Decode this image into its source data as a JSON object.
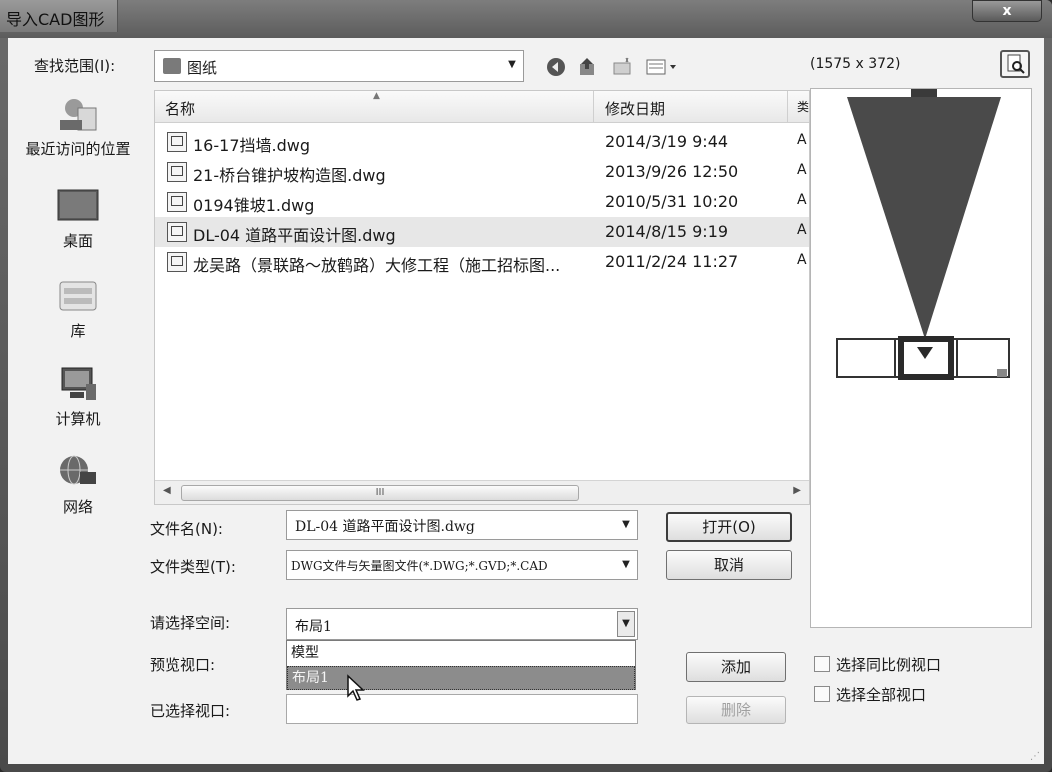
{
  "window": {
    "title": "导入CAD图形",
    "close_glyph": "x"
  },
  "lookin": {
    "label": "查找范围(I):",
    "value": "图纸"
  },
  "toolbar": {
    "back_icon": "globe-back-icon",
    "up_icon": "up-folder-icon",
    "newfolder_icon": "new-folder-icon",
    "views_icon": "views-menu-icon"
  },
  "places": [
    {
      "label": "最近访问的位置",
      "icon": "recent-places-icon"
    },
    {
      "label": "桌面",
      "icon": "desktop-icon"
    },
    {
      "label": "库",
      "icon": "libraries-icon"
    },
    {
      "label": "计算机",
      "icon": "computer-icon"
    },
    {
      "label": "网络",
      "icon": "network-icon"
    }
  ],
  "filelist": {
    "columns": [
      "名称",
      "修改日期",
      "类"
    ],
    "rows": [
      {
        "name": "16-17挡墙.dwg",
        "date": "2014/3/19 9:44",
        "extra": "A",
        "selected": false
      },
      {
        "name": "21-桥台锥护坡构造图.dwg",
        "date": "2013/9/26 12:50",
        "extra": "A",
        "selected": false
      },
      {
        "name": "0194锥坡1.dwg",
        "date": "2010/5/31 10:20",
        "extra": "A",
        "selected": false
      },
      {
        "name": "DL-04 道路平面设计图.dwg",
        "date": "2014/8/15 9:19",
        "extra": "A",
        "selected": true
      },
      {
        "name": "龙吴路（景联路～放鹤路）大修工程（施工招标图...",
        "date": "2011/2/24 11:27",
        "extra": "A",
        "selected": false
      }
    ],
    "scroll_glyph": "III"
  },
  "filename": {
    "label": "文件名(N):",
    "value": "DL-04 道路平面设计图.dwg"
  },
  "filetype": {
    "label": "文件类型(T):",
    "value": "DWG文件与矢量图文件(*.DWG;*.GVD;*.CAD"
  },
  "buttons": {
    "open": "打开(O)",
    "cancel": "取消",
    "add": "添加",
    "delete": "删除"
  },
  "space": {
    "label": "请选择空间:",
    "value": "布局1",
    "options": [
      "模型",
      "布局1"
    ],
    "highlighted": 1
  },
  "preview_viewport": {
    "label": "预览视口:"
  },
  "selected_viewport": {
    "label": "已选择视口:",
    "value": ""
  },
  "preview": {
    "size_text": "(1575 x 372)"
  },
  "checks": {
    "same_scale": "选择同比例视口",
    "select_all": "选择全部视口"
  }
}
